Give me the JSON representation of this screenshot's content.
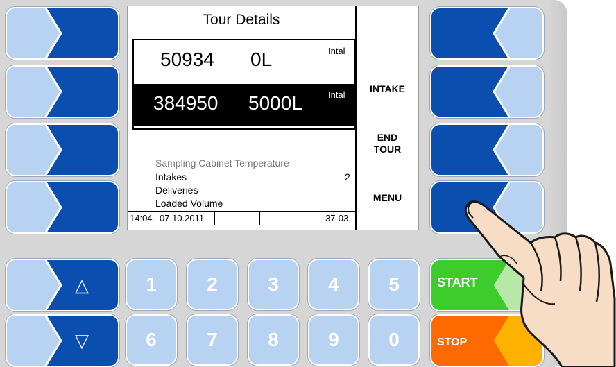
{
  "screen": {
    "title": "Tour Details",
    "rows": [
      {
        "number": "50934",
        "volume": "0L",
        "type": "Intal"
      },
      {
        "number": "384950",
        "volume": "5000L",
        "type": "Intal"
      }
    ],
    "menu": {
      "intake": "INTAKE",
      "end_tour_line1": "END",
      "end_tour_line2": "TOUR",
      "menu": "MENU"
    },
    "info": {
      "sampling": "Sampling Cabinet Temperature",
      "intakes_label": "Intakes",
      "intakes_value": "2",
      "deliveries_label": "Deliveries",
      "loaded_volume_label": "Loaded Volume"
    },
    "status": {
      "time": "14:04",
      "date": "07.10.2011",
      "code": "37-03"
    }
  },
  "keys": {
    "up": "△",
    "down": "▽",
    "numbers_top": [
      "1",
      "2",
      "3",
      "4",
      "5"
    ],
    "numbers_bottom": [
      "6",
      "7",
      "8",
      "9",
      "0"
    ],
    "start": "START",
    "stop": "STOP"
  },
  "colors": {
    "softkey_light": "#b8d2f2",
    "softkey_dark": "#0a4fb0",
    "start": "#3ccc2c",
    "stop": "#ff6a00"
  }
}
